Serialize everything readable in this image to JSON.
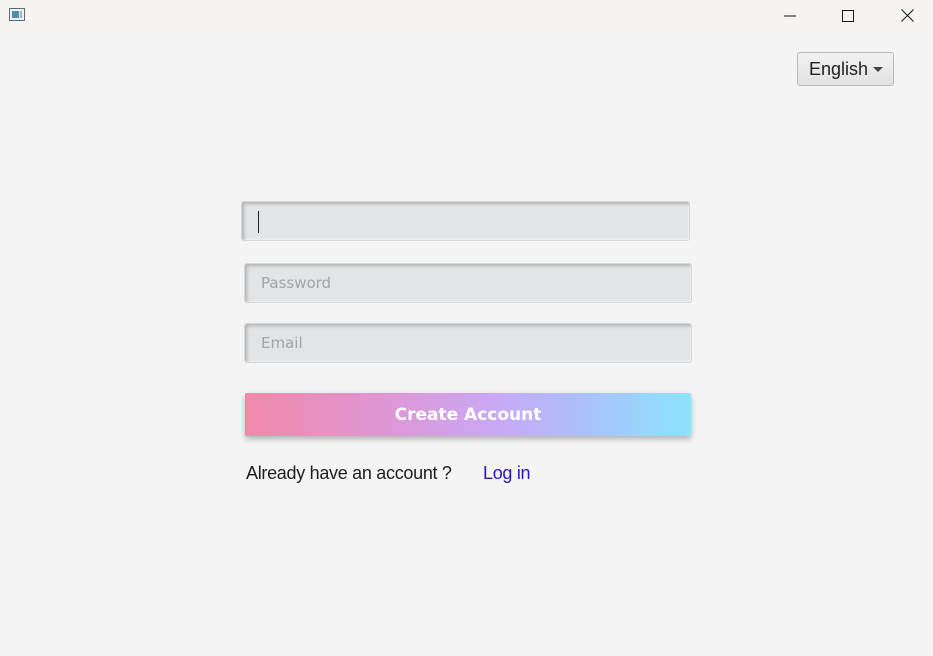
{
  "window": {
    "app_icon": "app-window-icon",
    "controls": {
      "minimize_icon": "minimize-icon",
      "maximize_icon": "maximize-icon",
      "close_icon": "close-icon"
    }
  },
  "language": {
    "selected": "English",
    "icon": "chevron-down-icon"
  },
  "form": {
    "username": {
      "value": "",
      "placeholder": ""
    },
    "password": {
      "value": "",
      "placeholder": "Password"
    },
    "email": {
      "value": "",
      "placeholder": "Email"
    },
    "create_label": "Create Account",
    "already_text": "Already have an account ?",
    "login_label": "Log in"
  },
  "colors": {
    "background": "#f4f4f4",
    "field_bg": "#e3e4e5",
    "button_gradient_start": "#f18aa8",
    "button_gradient_end": "#8ce4fb",
    "link": "#2a16b8"
  }
}
